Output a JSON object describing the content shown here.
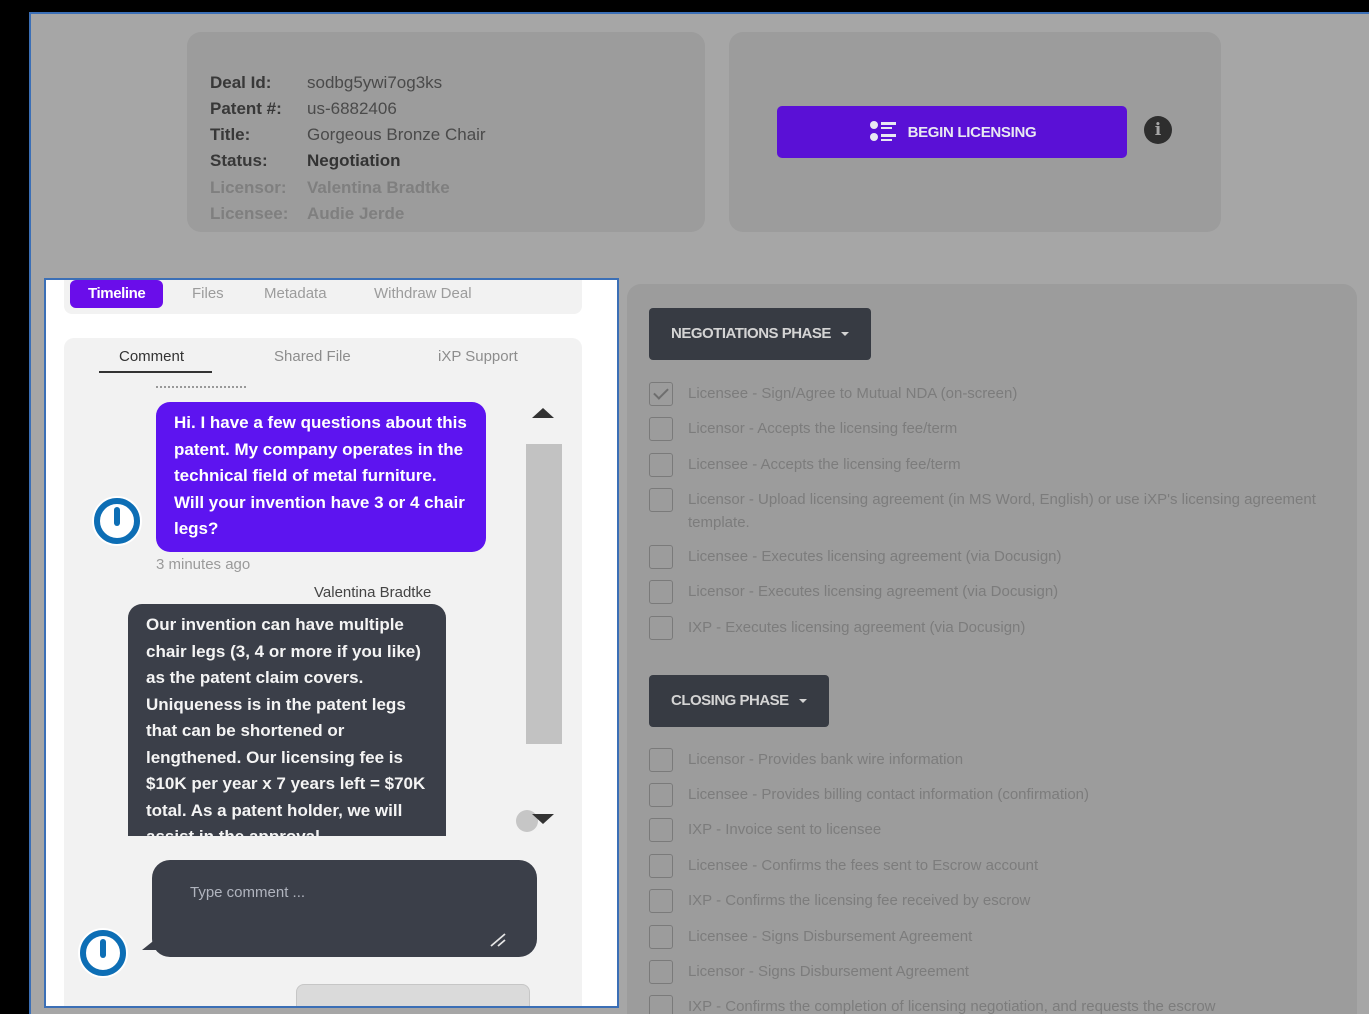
{
  "deal": {
    "deal_id_label": "Deal Id:",
    "deal_id": "sodbg5ywi7og3ks",
    "patent_label": "Patent #:",
    "patent": "us-6882406",
    "title_label": "Title:",
    "title": "Gorgeous Bronze Chair",
    "status_label": "Status:",
    "status": "Negotiation",
    "licensor_label": "Licensor:",
    "licensor": "Valentina Bradtke",
    "licensee_label": "Licensee:",
    "licensee": "Audie Jerde"
  },
  "actions": {
    "begin_licensing_label": "BEGIN LICENSING",
    "info_icon": "i"
  },
  "tabs": [
    "Timeline",
    "Files",
    "Metadata",
    "Withdraw Deal"
  ],
  "subtabs": [
    "Comment",
    "Shared File",
    "iXP Support"
  ],
  "messages": [
    {
      "text": "Hi. I have a few questions about this patent. My company operates in the technical field of metal furniture. Will your invention have 3 or 4 chair legs?",
      "time": "3 minutes ago"
    },
    {
      "author": "Valentina Bradtke",
      "text": "Our invention can have multiple chair legs (3, 4 or more if you like) as the patent claim covers. Uniqueness is in the patent legs that can be shortened or lengthened. Our licensing fee is $10K per year x 7 years left = $70K total. As a patent holder, we will assist in the approval"
    }
  ],
  "comment": {
    "placeholder": "Type comment ..."
  },
  "phases": {
    "negotiations": {
      "label": "NEGOTIATIONS PHASE",
      "tasks": [
        {
          "label": "Licensee - Sign/Agree to Mutual NDA (on-screen)",
          "checked": true
        },
        {
          "label": "Licensor - Accepts the licensing fee/term",
          "checked": false
        },
        {
          "label": "Licensee - Accepts the licensing fee/term",
          "checked": false
        },
        {
          "label": "Licensor - Upload licensing agreement (in MS Word, English) or use iXP's licensing agreement template.",
          "checked": false
        },
        {
          "label": "Licensee - Executes licensing agreement (via Docusign)",
          "checked": false
        },
        {
          "label": "Licensor - Executes licensing agreement (via Docusign)",
          "checked": false
        },
        {
          "label": "IXP - Executes licensing agreement (via Docusign)",
          "checked": false
        }
      ]
    },
    "closing": {
      "label": "CLOSING PHASE",
      "tasks": [
        {
          "label": "Licensor - Provides bank wire information",
          "checked": false
        },
        {
          "label": "Licensee - Provides billing contact information (confirmation)",
          "checked": false
        },
        {
          "label": "IXP - Invoice sent to licensee",
          "checked": false
        },
        {
          "label": "Licensee - Confirms the fees sent to Escrow account",
          "checked": false
        },
        {
          "label": "IXP - Confirms the licensing fee received by escrow",
          "checked": false
        },
        {
          "label": "Licensee - Signs Disbursement Agreement",
          "checked": false
        },
        {
          "label": "Licensor - Signs Disbursement Agreement",
          "checked": false
        },
        {
          "label": "IXP - Confirms the completion of licensing negotiation, and requests the escrow",
          "checked": false
        }
      ]
    }
  },
  "colors": {
    "accent": "#5d14f0",
    "dark_bubble": "#3b3f49",
    "avatar_blue": "#0d6eb5"
  }
}
